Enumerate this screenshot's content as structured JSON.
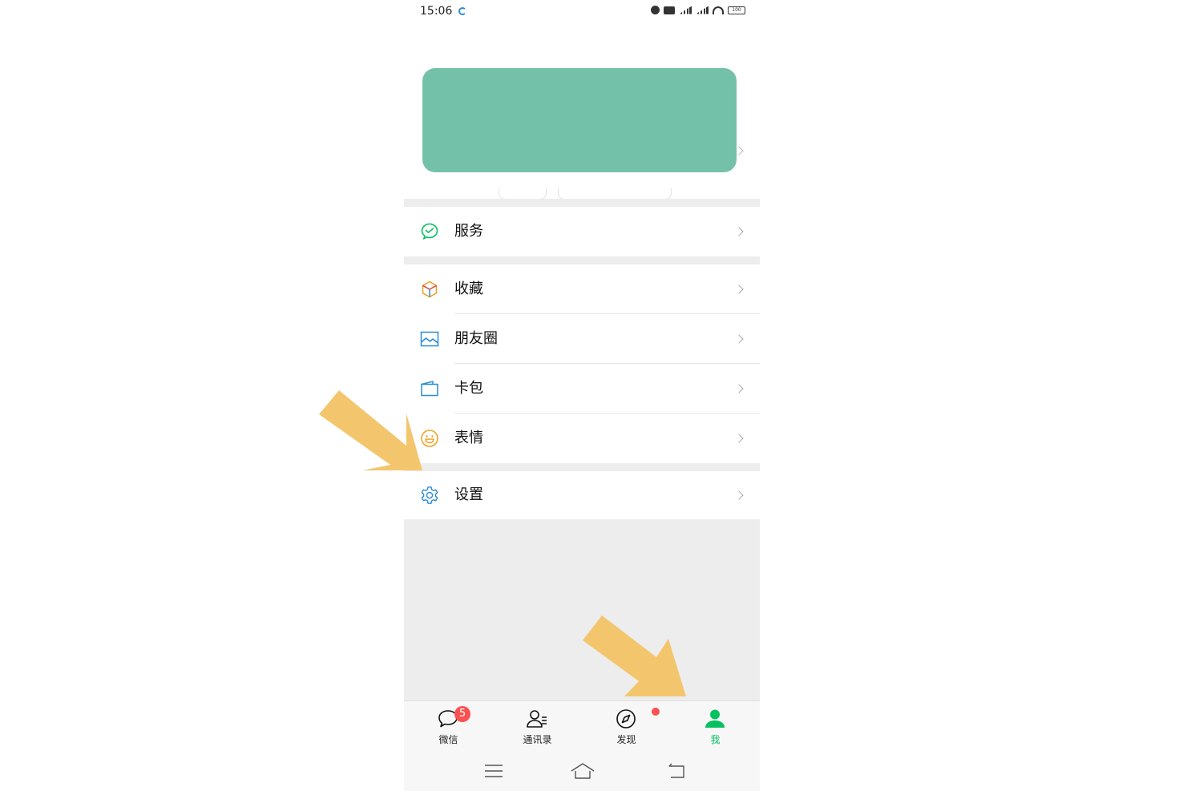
{
  "status_bar": {
    "time": "15:06",
    "battery": "100"
  },
  "menu": {
    "service": "服务",
    "favorites": "收藏",
    "moments": "朋友圈",
    "cards": "卡包",
    "stickers": "表情",
    "settings": "设置"
  },
  "tabs": [
    {
      "label": "微信",
      "icon": "chat-bubble-icon",
      "badge": "5"
    },
    {
      "label": "通讯录",
      "icon": "contacts-icon"
    },
    {
      "label": "发现",
      "icon": "compass-icon",
      "dot": true
    },
    {
      "label": "我",
      "icon": "person-icon",
      "active": true
    }
  ],
  "colors": {
    "accent": "#07c160",
    "cover": "#74c1aa",
    "badge": "#fa5151",
    "annotation_arrow": "#f3c66e",
    "divider_bg": "#ededed"
  }
}
